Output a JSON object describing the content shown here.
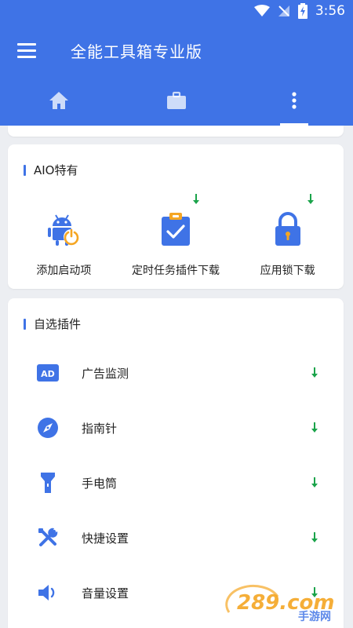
{
  "status": {
    "time": "3:56"
  },
  "app": {
    "title": "全能工具箱专业版"
  },
  "tabs": [
    {
      "id": "home",
      "icon": "home-icon"
    },
    {
      "id": "tools",
      "icon": "briefcase-icon"
    },
    {
      "id": "more",
      "icon": "more-vert-icon",
      "active": true
    }
  ],
  "aio": {
    "section_title": "AIO特有",
    "items": [
      {
        "label": "添加启动项",
        "icon": "android-power-icon",
        "download": false
      },
      {
        "label": "定时任务插件下载",
        "icon": "clipboard-check-icon",
        "download": true
      },
      {
        "label": "应用锁下载",
        "icon": "lock-icon",
        "download": true
      }
    ]
  },
  "plugins": {
    "section_title": "自选插件",
    "items": [
      {
        "label": "广告监测",
        "icon": "ad-badge-icon"
      },
      {
        "label": "指南针",
        "icon": "compass-icon"
      },
      {
        "label": "手电筒",
        "icon": "flashlight-icon"
      },
      {
        "label": "快捷设置",
        "icon": "tools-icon"
      },
      {
        "label": "音量设置",
        "icon": "speaker-icon"
      }
    ]
  },
  "watermark": {
    "text": "289.com",
    "subtext": "手游网"
  },
  "colors": {
    "primary": "#3f73e6",
    "download_green": "#1aa34a",
    "background": "#eceef2"
  }
}
